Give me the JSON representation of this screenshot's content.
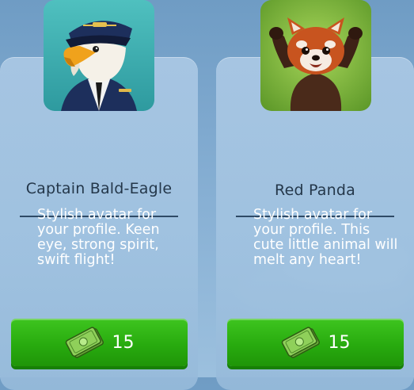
{
  "items": [
    {
      "title": "Captain Bald-Eagle",
      "description": "Stylish avatar for\nyour profile. Keen\neye, strong spirit,\nswift flight!",
      "price": "15",
      "avatar_icon": "bald-eagle-captain-avatar",
      "currency_icon": "cash-bills-icon"
    },
    {
      "title": "Red Panda",
      "description": "Stylish avatar for\nyour profile. This\ncute little animal will\nmelt any heart!",
      "price": "15",
      "avatar_icon": "red-panda-avatar",
      "currency_icon": "cash-bills-icon"
    }
  ],
  "colors": {
    "button_green": "#2bb012",
    "title_text": "#24374a",
    "card_bg": "#a6c4e2"
  }
}
